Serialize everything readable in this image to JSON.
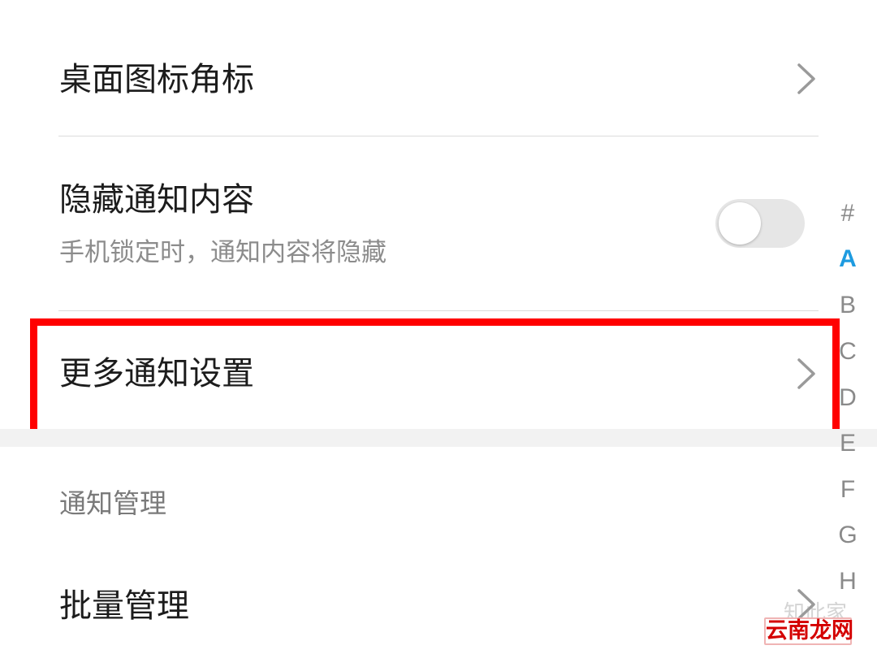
{
  "items": {
    "badge": {
      "title": "桌面图标角标"
    },
    "hide_content": {
      "title": "隐藏通知内容",
      "subtitle": "手机锁定时，通知内容将隐藏",
      "toggle_on": false
    },
    "more_settings": {
      "title": "更多通知设置"
    },
    "batch": {
      "title": "批量管理"
    }
  },
  "section": {
    "header": "通知管理"
  },
  "index_bar": {
    "letters": [
      "#",
      "A",
      "B",
      "C",
      "D",
      "E",
      "F",
      "G",
      "H"
    ],
    "active": "A"
  },
  "highlight": {
    "color": "#ff0000"
  },
  "watermark": {
    "top_text": "知此家",
    "logo_text": "云南龙网"
  },
  "icons": {
    "chevron": "chevron-right-icon"
  }
}
